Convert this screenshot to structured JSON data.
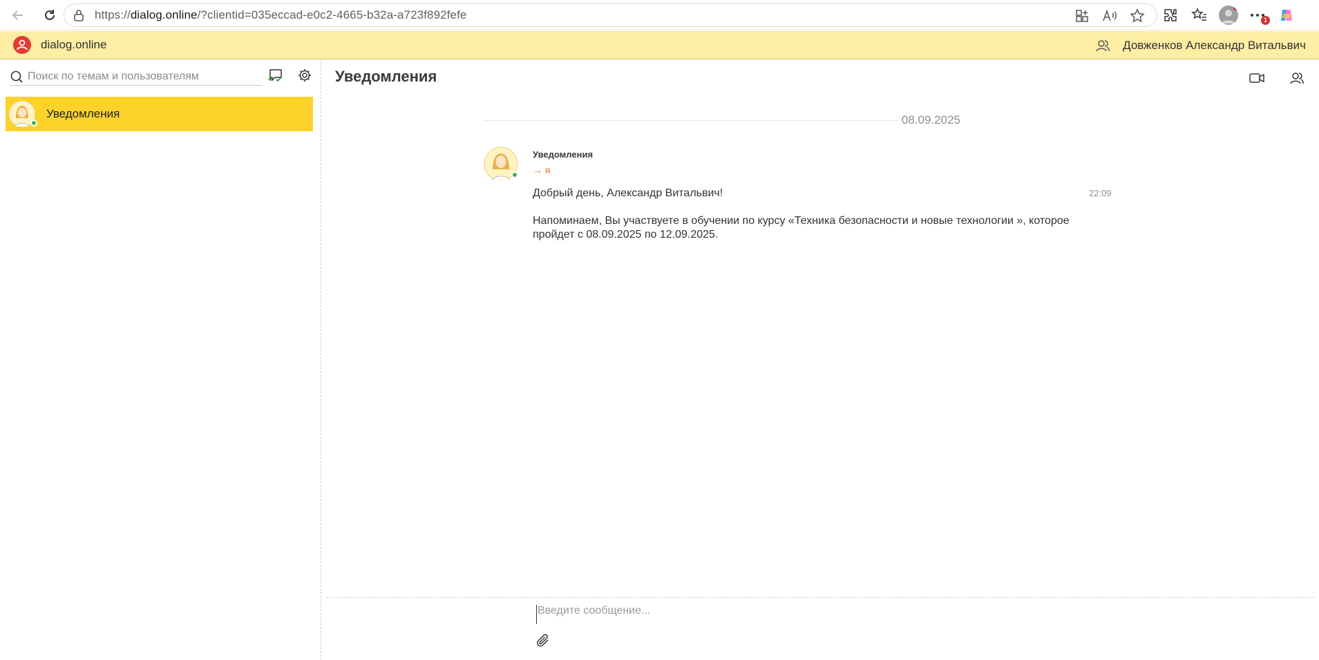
{
  "browser": {
    "url_prefix": "https://",
    "url_domain": "dialog.online",
    "url_rest": "/?clientid=035eccad-e0c2-4665-b32a-a723f892fefe",
    "notifications_count": "1"
  },
  "app": {
    "name": "dialog.online",
    "user_name": "Довженков Александр Витальвич",
    "accent_color": "#fcd22b",
    "header_color": "#fdeea4"
  },
  "sidebar": {
    "search_placeholder": "Поиск по темам и пользователям",
    "threads": [
      {
        "label": "Уведомления",
        "selected": true
      }
    ]
  },
  "conversation": {
    "title": "Уведомления",
    "date": "08.09.2025",
    "message": {
      "sender": "Уведомления",
      "recipient": "→ я",
      "time": "22:09",
      "greeting": "Добрый день, Александр Витальвич!",
      "body": "Напоминаем, Вы участвуете в обучении по курсу «Техника безопасности и новые технологии », которое пройдет с 08.09.2025 по 12.09.2025."
    },
    "composer_placeholder": "Введите сообщение..."
  }
}
